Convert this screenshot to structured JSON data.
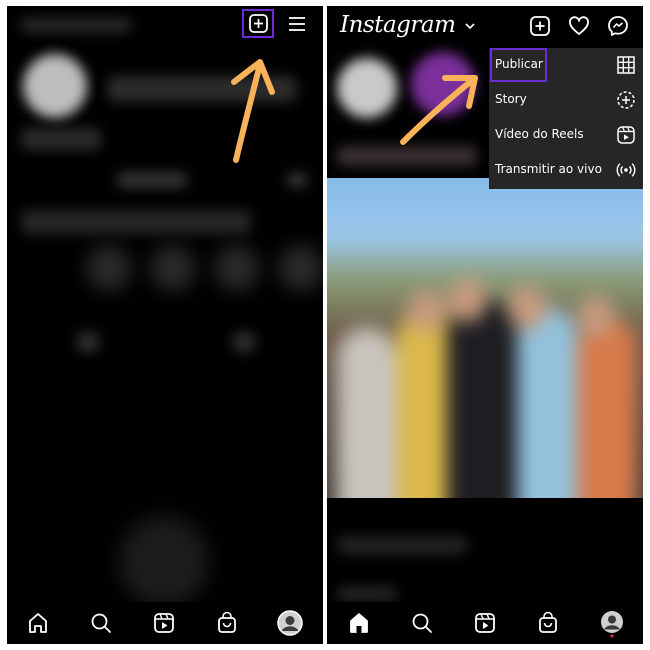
{
  "left_screen": {
    "new_post_label": "Nova publicação",
    "menu_label": "Menu"
  },
  "right_screen": {
    "app_logo": "Instagram",
    "create_menu": {
      "items": [
        {
          "label": "Publicar",
          "icon": "grid-icon"
        },
        {
          "label": "Story",
          "icon": "story-add-icon"
        },
        {
          "label": "Vídeo do Reels",
          "icon": "reels-icon"
        },
        {
          "label": "Transmitir ao vivo",
          "icon": "live-icon"
        }
      ]
    }
  },
  "bottom_nav": [
    "home-icon",
    "search-icon",
    "reels-icon",
    "shop-icon",
    "profile-avatar"
  ],
  "colors": {
    "highlight": "#6b2bd6",
    "arrow": "#f7b25a",
    "menu_bg": "#262626",
    "notification_dot": "#e0245e"
  }
}
